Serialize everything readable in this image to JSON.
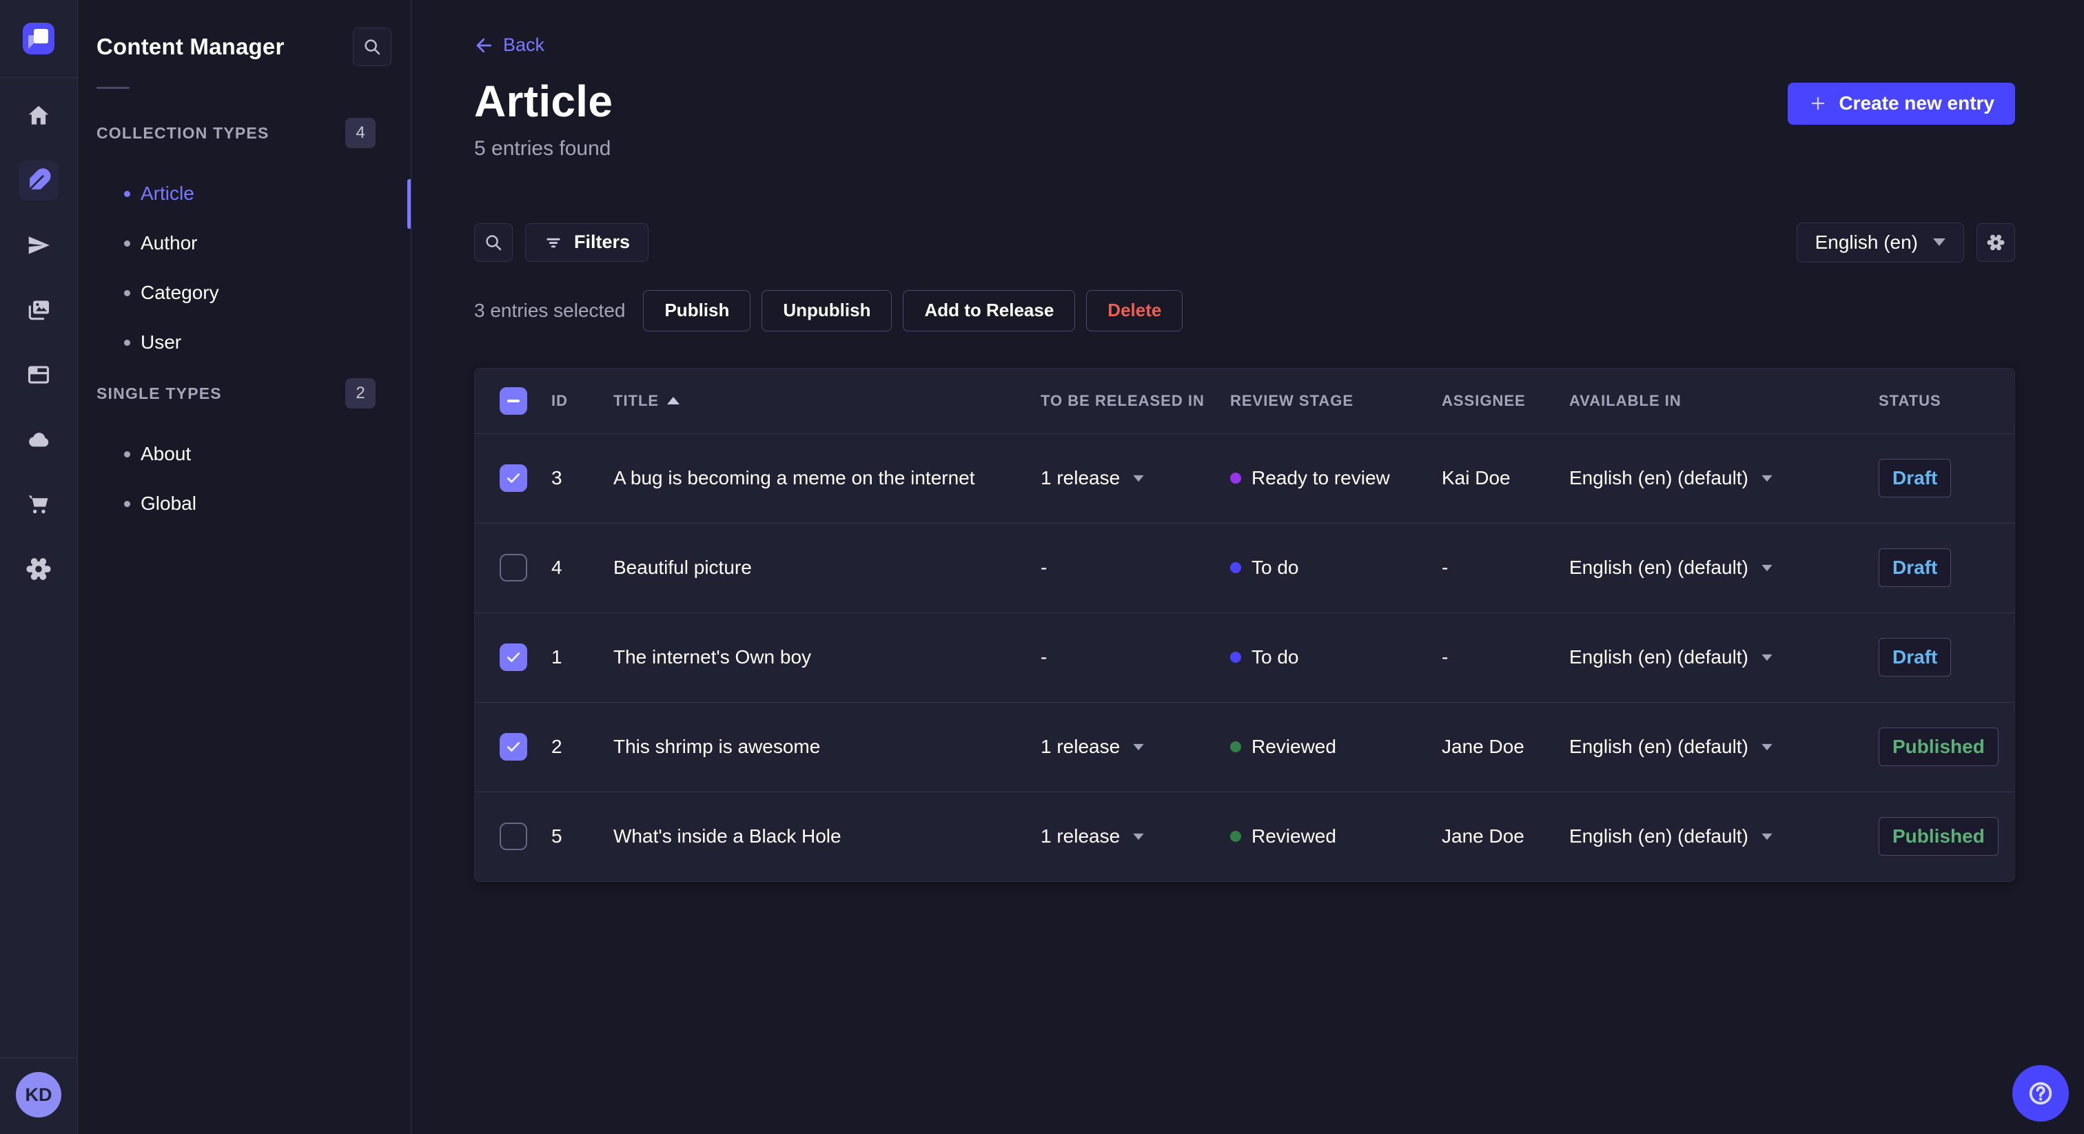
{
  "icon_rail": {
    "icons": [
      "home",
      "content-manager",
      "releases",
      "media-library",
      "content-type-builder",
      "cloud",
      "marketplace",
      "settings"
    ],
    "active_icon": "content-manager",
    "avatar_initials": "KD"
  },
  "subnav": {
    "title": "Content Manager",
    "sections": [
      {
        "label": "COLLECTION TYPES",
        "badge": "4",
        "items": [
          {
            "label": "Article",
            "active": true
          },
          {
            "label": "Author",
            "active": false
          },
          {
            "label": "Category",
            "active": false
          },
          {
            "label": "User",
            "active": false
          }
        ]
      },
      {
        "label": "SINGLE TYPES",
        "badge": "2",
        "items": [
          {
            "label": "About",
            "active": false
          },
          {
            "label": "Global",
            "active": false
          }
        ]
      }
    ]
  },
  "header": {
    "back_label": "Back",
    "title": "Article",
    "subtitle": "5 entries found",
    "create_button_label": "Create new entry"
  },
  "toolbar": {
    "filters_label": "Filters",
    "locale_selected": "English (en)"
  },
  "selection": {
    "text": "3 entries selected",
    "publish_label": "Publish",
    "unpublish_label": "Unpublish",
    "add_to_release_label": "Add to Release",
    "delete_label": "Delete"
  },
  "table": {
    "select_all_state": "indeterminate",
    "columns": [
      "ID",
      "TITLE",
      "TO BE RELEASED IN",
      "REVIEW STAGE",
      "ASSIGNEE",
      "AVAILABLE IN",
      "STATUS"
    ],
    "sort": {
      "column": "TITLE",
      "direction": "asc"
    },
    "rows": [
      {
        "checked": true,
        "id": "3",
        "title": "A bug is becoming a meme on the internet",
        "release": "1 release",
        "review_stage": "Ready to review",
        "stage_color": "#9736e8",
        "assignee": "Kai Doe",
        "available": "English (en) (default)",
        "status": "Draft"
      },
      {
        "checked": false,
        "id": "4",
        "title": "Beautiful picture",
        "release": "-",
        "review_stage": "To do",
        "stage_color": "#4945ff",
        "assignee": "-",
        "available": "English (en) (default)",
        "status": "Draft"
      },
      {
        "checked": true,
        "id": "1",
        "title": "The internet's Own boy",
        "release": "-",
        "review_stage": "To do",
        "stage_color": "#4945ff",
        "assignee": "-",
        "available": "English (en) (default)",
        "status": "Draft"
      },
      {
        "checked": true,
        "id": "2",
        "title": "This shrimp is awesome",
        "release": "1 release",
        "review_stage": "Reviewed",
        "stage_color": "#328048",
        "assignee": "Jane Doe",
        "available": "English (en) (default)",
        "status": "Published"
      },
      {
        "checked": false,
        "id": "5",
        "title": "What's inside a Black Hole",
        "release": "1 release",
        "review_stage": "Reviewed",
        "stage_color": "#328048",
        "assignee": "Jane Doe",
        "available": "English (en) (default)",
        "status": "Published"
      }
    ]
  },
  "colors": {
    "accent": "#4945ff",
    "accent_light": "#7b79ff",
    "status_draft": "#66b7f1",
    "status_published": "#5cb176",
    "danger": "#ee5e52",
    "stage_todo": "#4945ff",
    "stage_ready_to_review": "#9736e8",
    "stage_reviewed": "#328048"
  },
  "help": {
    "icon": "question-circle"
  }
}
